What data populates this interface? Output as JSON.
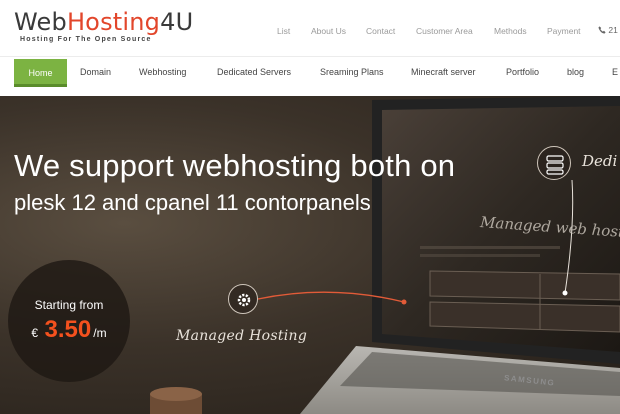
{
  "brand": {
    "logo_part1": "Web",
    "logo_part2": "Hosting",
    "logo_part3": "4U",
    "tagline": "Hosting For The Open Source",
    "accent_color": "#e2462b"
  },
  "top_links": [
    "List",
    "About Us",
    "Contact",
    "Customer Area",
    "Methods",
    "Payment"
  ],
  "phone": {
    "icon": "phone-icon",
    "text": "21"
  },
  "main_nav": {
    "active_color": "#7cb342",
    "items": [
      "Home",
      "Domain",
      "Webhosting",
      "Dedicated Servers",
      "Sreaming Plans",
      "Minecraft server",
      "Portfolio",
      "blog",
      "E"
    ]
  },
  "hero": {
    "headline": "We support webhosting both on",
    "subline": "plesk 12 and cpanel 11 contorpanels",
    "price_intro": "Starting from",
    "currency": "€",
    "amount": "3.50",
    "period": "/m",
    "price_color": "#f4511e",
    "feature_managed": "Managed Hosting",
    "feature_dedicated": "Dedi",
    "screen_text": "Managed web host",
    "laptop_brand": "SAMSUNG"
  }
}
